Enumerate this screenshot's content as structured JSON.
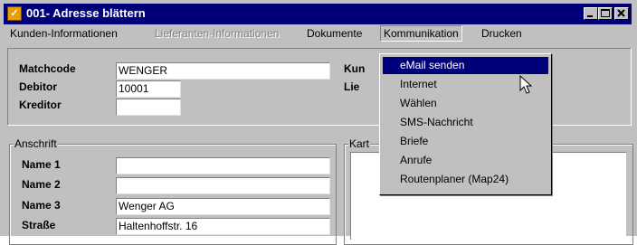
{
  "window": {
    "title": "001- Adresse blättern",
    "icon": "app-icon",
    "buttons": [
      "minimize",
      "maximize",
      "close"
    ]
  },
  "menubar": {
    "items": [
      {
        "label": "Kunden-Informationen",
        "state": "enabled"
      },
      {
        "label": "Lieferanten-Informationen",
        "state": "disabled"
      },
      {
        "label": "Dokumente",
        "state": "enabled"
      },
      {
        "label": "Kommunikation",
        "state": "open"
      },
      {
        "label": "Drucken",
        "state": "enabled"
      }
    ]
  },
  "top_panel": {
    "matchcode_label": "Matchcode",
    "matchcode_value": "WENGER",
    "debitor_label": "Debitor",
    "debitor_value": "10001",
    "kreditor_label": "Kreditor",
    "kreditor_value": "",
    "kun_label": "Kun",
    "lie_label": "Lie"
  },
  "anschrift": {
    "title": "Anschrift",
    "name1_label": "Name 1",
    "name1_value": "",
    "name2_label": "Name 2",
    "name2_value": "",
    "name3_label": "Name 3",
    "name3_value": "Wenger AG",
    "strasse_label": "Straße",
    "strasse_value": "Haltenhoffstr. 16"
  },
  "karte": {
    "title": "Kart"
  },
  "kommunikation_menu": {
    "items": [
      {
        "label": "eMail senden",
        "highlighted": true
      },
      {
        "label": "Internet",
        "highlighted": false
      },
      {
        "label": "Wählen",
        "highlighted": false
      },
      {
        "label": "SMS-Nachricht",
        "highlighted": false
      },
      {
        "label": "Briefe",
        "highlighted": false
      },
      {
        "label": "Anrufe",
        "highlighted": false
      },
      {
        "label": "Routenplaner (Map24)",
        "highlighted": false
      }
    ]
  },
  "colors": {
    "title_bar": "#00007b",
    "highlight": "#00007b",
    "face": "#c0c0c0"
  }
}
